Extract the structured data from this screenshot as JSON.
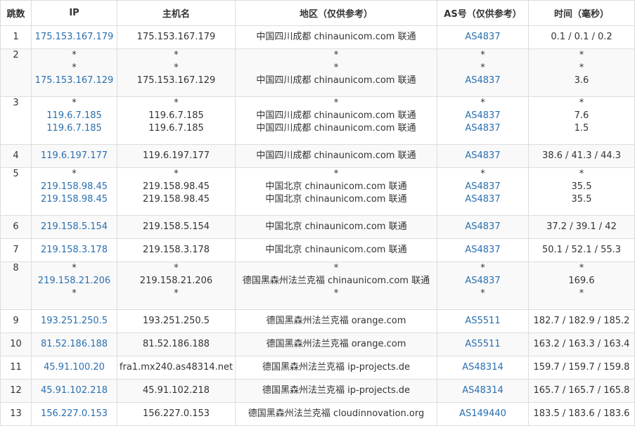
{
  "columns": [
    "跳数",
    "IP",
    "主机名",
    "地区（仅供参考）",
    "AS号（仅供参考）",
    "时间（毫秒）"
  ],
  "rows": [
    {
      "hop": "1",
      "lines": [
        {
          "ip": "175.153.167.179",
          "host": "175.153.167.179",
          "region": "中国四川成都 chinaunicom.com 联通",
          "as": "AS4837",
          "time": "0.1 / 0.1 / 0.2"
        }
      ]
    },
    {
      "hop": "2",
      "lines": [
        {
          "ip": "*",
          "host": "*",
          "region": "*",
          "as": "*",
          "time": "*"
        },
        {
          "ip": "*",
          "host": "*",
          "region": "*",
          "as": "*",
          "time": "*"
        },
        {
          "ip": "175.153.167.129",
          "host": "175.153.167.129",
          "region": "中国四川成都 chinaunicom.com 联通",
          "as": "AS4837",
          "time": "3.6"
        }
      ]
    },
    {
      "hop": "3",
      "lines": [
        {
          "ip": "*",
          "host": "*",
          "region": "*",
          "as": "*",
          "time": "*"
        },
        {
          "ip": "119.6.7.185",
          "host": "119.6.7.185",
          "region": "中国四川成都 chinaunicom.com 联通",
          "as": "AS4837",
          "time": "7.6"
        },
        {
          "ip": "119.6.7.185",
          "host": "119.6.7.185",
          "region": "中国四川成都 chinaunicom.com 联通",
          "as": "AS4837",
          "time": "1.5"
        }
      ]
    },
    {
      "hop": "4",
      "lines": [
        {
          "ip": "119.6.197.177",
          "host": "119.6.197.177",
          "region": "中国四川成都 chinaunicom.com 联通",
          "as": "AS4837",
          "time": "38.6 / 41.3 / 44.3"
        }
      ]
    },
    {
      "hop": "5",
      "lines": [
        {
          "ip": "*",
          "host": "*",
          "region": "*",
          "as": "*",
          "time": "*"
        },
        {
          "ip": "219.158.98.45",
          "host": "219.158.98.45",
          "region": "中国北京 chinaunicom.com 联通",
          "as": "AS4837",
          "time": "35.5"
        },
        {
          "ip": "219.158.98.45",
          "host": "219.158.98.45",
          "region": "中国北京 chinaunicom.com 联通",
          "as": "AS4837",
          "time": "35.5"
        }
      ]
    },
    {
      "hop": "6",
      "lines": [
        {
          "ip": "219.158.5.154",
          "host": "219.158.5.154",
          "region": "中国北京 chinaunicom.com 联通",
          "as": "AS4837",
          "time": "37.2 / 39.1 / 42"
        }
      ]
    },
    {
      "hop": "7",
      "lines": [
        {
          "ip": "219.158.3.178",
          "host": "219.158.3.178",
          "region": "中国北京 chinaunicom.com 联通",
          "as": "AS4837",
          "time": "50.1 / 52.1 / 55.3"
        }
      ]
    },
    {
      "hop": "8",
      "lines": [
        {
          "ip": "*",
          "host": "*",
          "region": "*",
          "as": "*",
          "time": "*"
        },
        {
          "ip": "219.158.21.206",
          "host": "219.158.21.206",
          "region": "德国黑森州法兰克福 chinaunicom.com 联通",
          "as": "AS4837",
          "time": "169.6"
        },
        {
          "ip": "*",
          "host": "*",
          "region": "*",
          "as": "*",
          "time": "*"
        }
      ]
    },
    {
      "hop": "9",
      "lines": [
        {
          "ip": "193.251.250.5",
          "host": "193.251.250.5",
          "region": "德国黑森州法兰克福 orange.com",
          "as": "AS5511",
          "time": "182.7 / 182.9 / 185.2"
        }
      ]
    },
    {
      "hop": "10",
      "lines": [
        {
          "ip": "81.52.186.188",
          "host": "81.52.186.188",
          "region": "德国黑森州法兰克福 orange.com",
          "as": "AS5511",
          "time": "163.2 / 163.3 / 163.4"
        }
      ]
    },
    {
      "hop": "11",
      "lines": [
        {
          "ip": "45.91.100.20",
          "host": "fra1.mx240.as48314.net",
          "region": "德国黑森州法兰克福 ip-projects.de",
          "as": "AS48314",
          "time": "159.7 / 159.7 / 159.8"
        }
      ]
    },
    {
      "hop": "12",
      "lines": [
        {
          "ip": "45.91.102.218",
          "host": "45.91.102.218",
          "region": "德国黑森州法兰克福 ip-projects.de",
          "as": "AS48314",
          "time": "165.7 / 165.7 / 165.8"
        }
      ]
    },
    {
      "hop": "13",
      "lines": [
        {
          "ip": "156.227.0.153",
          "host": "156.227.0.153",
          "region": "德国黑森州法兰克福 cloudinnovation.org",
          "as": "AS149440",
          "time": "183.5 / 183.6 / 183.6"
        }
      ]
    }
  ]
}
